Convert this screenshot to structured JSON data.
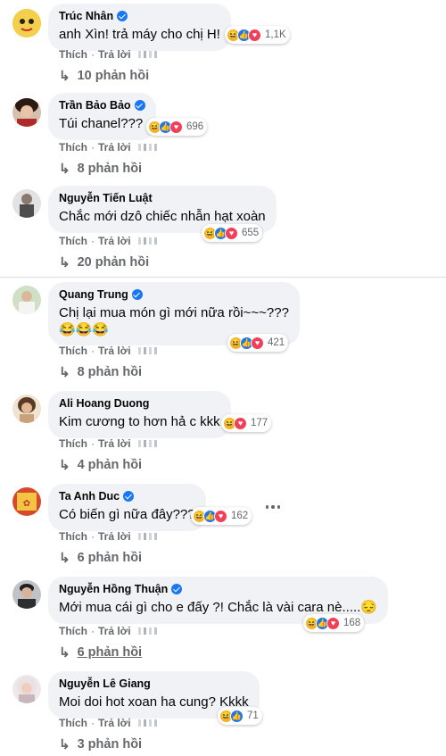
{
  "action_labels": {
    "like": "Thích",
    "reply": "Trả lời",
    "separator": "·"
  },
  "comments": [
    {
      "name": "Trúc Nhân",
      "verified": true,
      "text": "anh Xìn! trả máy cho chị H!",
      "reactions": [
        "haha",
        "like",
        "love"
      ],
      "count": "1,1K",
      "replies": "10 phản hồi",
      "avatar_color": "#f1c34a"
    },
    {
      "name": "Trần Bảo Bảo",
      "verified": true,
      "text": "Túi chanel???",
      "reactions": [
        "haha",
        "like",
        "love"
      ],
      "count": "696",
      "replies": "8 phản hồi",
      "avatar_color": "#7a2b2b"
    },
    {
      "name": "Nguyễn Tiến Luật",
      "verified": false,
      "text": "Chắc mới dzô chiếc nhẫn hạt xoàn",
      "reactions": [
        "haha",
        "like",
        "love"
      ],
      "count": "655",
      "replies": "20 phản hồi",
      "avatar_color": "#6b6b6b"
    },
    {
      "name": "Quang Trung",
      "verified": true,
      "text": "Chị lại mua món gì mới nữa rồi~~~???",
      "emoji_line": "😂😂😂",
      "reactions": [
        "haha",
        "like",
        "love"
      ],
      "count": "421",
      "replies": "8 phản hồi",
      "avatar_color": "#b9c7a8"
    },
    {
      "name": "Ali Hoang Duong",
      "verified": false,
      "text": "Kim cương to hơn hả c kkk",
      "reactions": [
        "haha",
        "love"
      ],
      "count": "177",
      "replies": "4 phản hồi",
      "avatar_color": "#c79a6e"
    },
    {
      "name": "Ta Anh Duc",
      "verified": true,
      "text": "Có biến gì nữa đây???",
      "reactions": [
        "haha",
        "like",
        "love"
      ],
      "count": "162",
      "replies": "6 phản hồi",
      "avatar_color": "#c2502b"
    },
    {
      "name": "Nguyễn Hồng Thuận",
      "verified": true,
      "text": "Mới mua cái gì cho e đấy ?! Chắc là vài cara nè.....😔",
      "reactions": [
        "haha",
        "like",
        "love"
      ],
      "count": "168",
      "replies": "6 phản hồi",
      "avatar_color": "#3d3a3a"
    },
    {
      "name": "Nguyễn Lê Giang",
      "verified": false,
      "text": "Moi doi hot xoan ha cung? Kkkk",
      "reactions": [
        "haha",
        "like"
      ],
      "count": "71",
      "replies": "3 phản hồi",
      "avatar_color": "#e7d3d8"
    }
  ]
}
